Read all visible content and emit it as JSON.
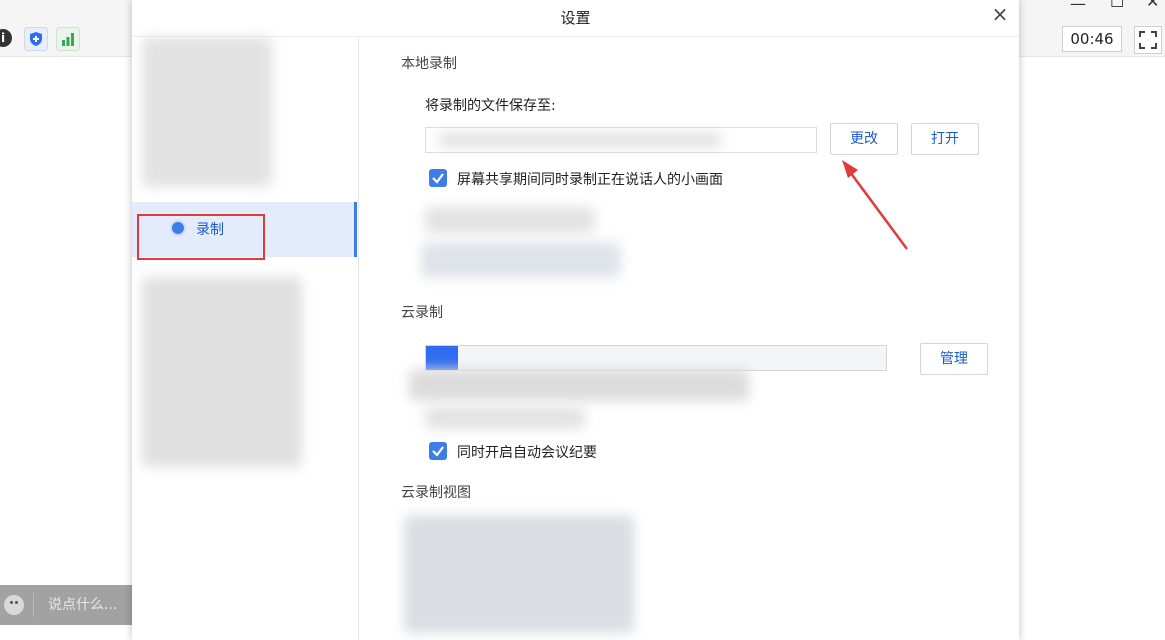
{
  "app": {
    "timer": "00:46",
    "chat_placeholder": "说点什么..."
  },
  "icons": [
    "info-icon",
    "shield-icon",
    "signal-icon",
    "minimize-icon",
    "maximize-icon",
    "close-icon",
    "fullscreen-icon",
    "emoji-icon",
    "check-icon"
  ],
  "dialog": {
    "title": "设置",
    "close_glyph": "×",
    "nav": {
      "selected_label": "录制"
    },
    "local_recording": {
      "section_title": "本地录制",
      "save_to_label": "将录制的文件保存至:",
      "change_button": "更改",
      "open_button": "打开",
      "record_speaker_checkbox": {
        "label": "屏幕共享期间同时录制正在说话人的小画面",
        "checked": true
      }
    },
    "cloud_recording": {
      "section_title": "云录制",
      "storage_fraction": 0.07,
      "manage_button": "管理",
      "auto_minutes_checkbox": {
        "label": "同时开启自动会议纪要",
        "checked": true
      }
    },
    "cloud_view": {
      "section_title": "云录制视图"
    }
  },
  "colors": {
    "accent": "#3f7de6",
    "link": "#1a5cc8",
    "annotation": "#e03a3a"
  }
}
